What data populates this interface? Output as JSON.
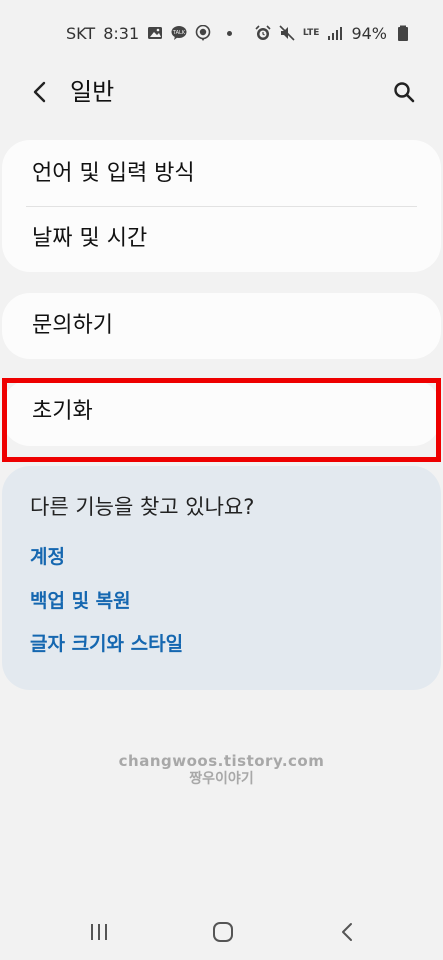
{
  "status_bar": {
    "carrier": "SKT",
    "time": "8:31",
    "network": "LTE",
    "battery": "94%"
  },
  "header": {
    "title": "일반"
  },
  "group1": {
    "items": [
      {
        "label": "언어 및 입력 방식"
      },
      {
        "label": "날짜 및 시간"
      }
    ]
  },
  "group2": {
    "items": [
      {
        "label": "문의하기"
      }
    ]
  },
  "group3": {
    "items": [
      {
        "label": "초기화"
      }
    ]
  },
  "suggestions": {
    "title": "다른 기능을 찾고 있나요?",
    "links": [
      {
        "label": "계정"
      },
      {
        "label": "백업 및 복원"
      },
      {
        "label": "글자 크기와 스타일"
      }
    ]
  },
  "watermark": {
    "line1": "changwoos.tistory.com",
    "line2": "짱우이야기"
  },
  "colors": {
    "background": "#f2f2f2",
    "card": "#fcfcfc",
    "suggestion_card": "#e3e9ef",
    "link": "#1567b0",
    "highlight": "#ee0000"
  }
}
